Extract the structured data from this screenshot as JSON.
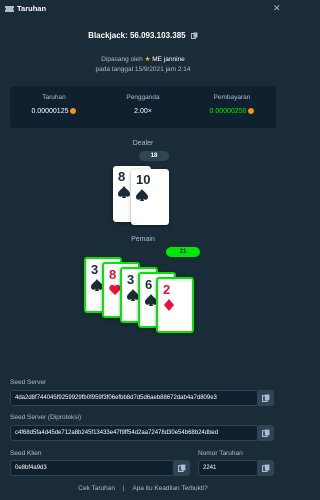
{
  "header": {
    "title": "Taruhan",
    "close": "✕"
  },
  "bet": {
    "game_id": "Blackjack: 56.093.103.385"
  },
  "placed": {
    "prefix": "Dipasang oleh",
    "user": "ME jannine",
    "date_line": "pada tanggal 15/9/2021 jam 2:14"
  },
  "stats": {
    "bet_label": "Taruhan",
    "bet_value": "0.00000125",
    "multiplier_label": "Pengganda",
    "multiplier_value": "2.00×",
    "payout_label": "Pembayaran",
    "payout_value": "0.00000250"
  },
  "dealer": {
    "label": "Dealer",
    "total": "18",
    "cards": [
      {
        "rank": "8",
        "suit": "spade"
      },
      {
        "rank": "10",
        "suit": "spade"
      }
    ]
  },
  "player": {
    "label": "Pemain",
    "total": "21",
    "cards": [
      {
        "rank": "3",
        "suit": "spade"
      },
      {
        "rank": "8",
        "suit": "heart"
      },
      {
        "rank": "3",
        "suit": "spade"
      },
      {
        "rank": "6",
        "suit": "spade"
      },
      {
        "rank": "2",
        "suit": "diamond"
      }
    ]
  },
  "seeds": {
    "server_label": "Seed Server",
    "server_value": "4da2d8f744045f9259929fb0f959f3f06efbb8d7d5d6aeb88672dab4a7d809e3",
    "hashed_label": "Seed Server (Diproteksi)",
    "hashed_value": "c4f68d5fa4d45de712a8b245f13433e47f9ff54d2aa72478d30e54b68b24dbed",
    "client_label": "Seed Klien",
    "client_value": "0e8bf4a9d3",
    "nonce_label": "Nomor Taruhan",
    "nonce_value": "2241"
  },
  "footer": {
    "check": "Cek Taruhan",
    "separator": "|",
    "fairness": "Apa itu Keadilan Terbukti?"
  },
  "colors": {
    "bg": "#1a2c38",
    "panel": "#0f212e",
    "green": "#00e701",
    "coin": "#f7931a"
  }
}
